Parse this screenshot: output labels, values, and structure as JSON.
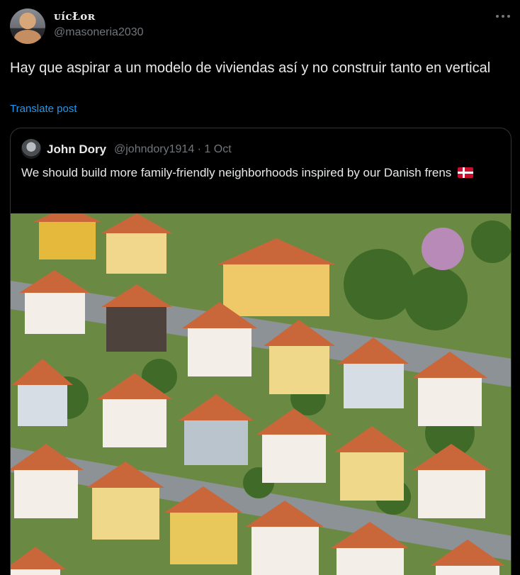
{
  "author": {
    "display_name": "ᴜíᴄŁᴏʀ",
    "handle": "@masoneria2030"
  },
  "tweet": {
    "text": "Hay que aspirar a un modelo de viviendas así y no construir tanto en vertical",
    "translate_label": "Translate post"
  },
  "quoted": {
    "name": "John Dory",
    "meta": "@johndory1914 · 1 Oct",
    "text": "We should build more family-friendly neighborhoods inspired by our Danish frens",
    "flag_icon": "denmark-flag-icon",
    "image_alt_icon": "aerial-houses-photo"
  },
  "colors": {
    "background": "#000000",
    "text": "#e7e9ea",
    "muted": "#71767b",
    "link": "#1d9bf0",
    "border": "#2f3336"
  }
}
